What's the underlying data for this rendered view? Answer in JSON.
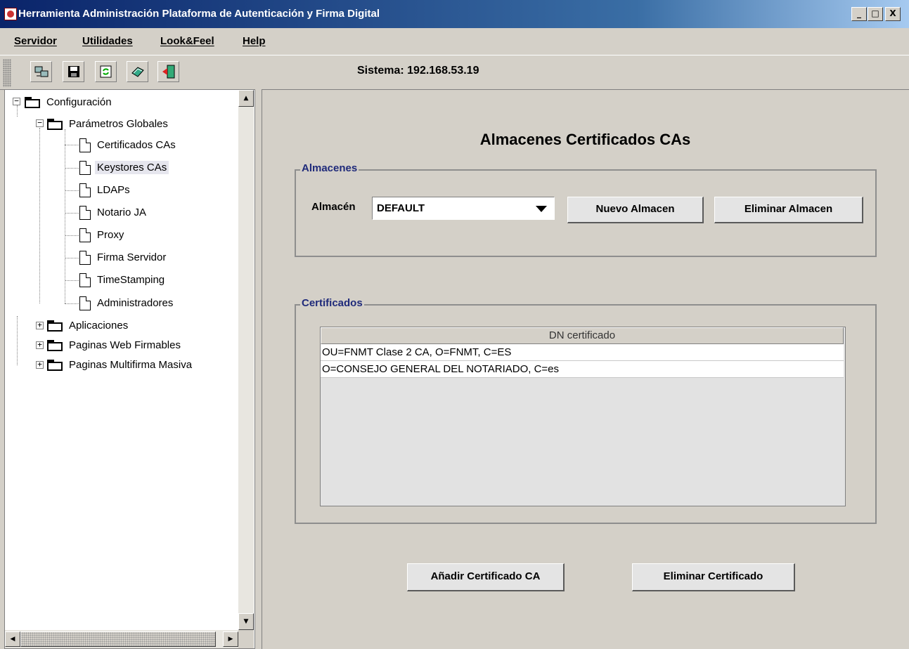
{
  "window": {
    "title": "Herramienta Administración Plataforma de Autenticación y Firma Digital",
    "controls": [
      "_",
      "□",
      "X"
    ]
  },
  "menu": [
    "Servidor",
    "Utilidades",
    "Look&Feel",
    "Help"
  ],
  "toolbar": {
    "buttons": [
      "network-icon",
      "save-icon",
      "refresh-icon",
      "help-book-icon",
      "exit-door-icon"
    ],
    "system_label": "Sistema:  192.168.53.19"
  },
  "tree": {
    "root": "Configuración",
    "global_params": "Parámetros Globales",
    "leaves": [
      "Certificados CAs",
      "Keystores CAs",
      "LDAPs",
      "Notario JA",
      "Proxy",
      "Firma Servidor",
      "TimeStamping",
      "Administradores"
    ],
    "selected": "Keystores CAs",
    "collapsed_folders": [
      "Aplicaciones",
      "Paginas Web Firmables",
      "Paginas Multifirma Masiva"
    ]
  },
  "main": {
    "title": "Almacenes Certificados CAs",
    "stores_group": "Almacenes",
    "store_label": "Almacén",
    "store_selected": "DEFAULT",
    "new_store_button": "Nuevo Almacen",
    "delete_store_button": "Eliminar Almacen",
    "certs_group": "Certificados",
    "table_header": "DN certificado",
    "table_rows": [
      "OU=FNMT Clase 2 CA, O=FNMT, C=ES",
      "O=CONSEJO GENERAL DEL NOTARIADO, C=es"
    ],
    "add_cert_button": "Añadir Certificado CA",
    "delete_cert_button": "Eliminar Certificado"
  }
}
